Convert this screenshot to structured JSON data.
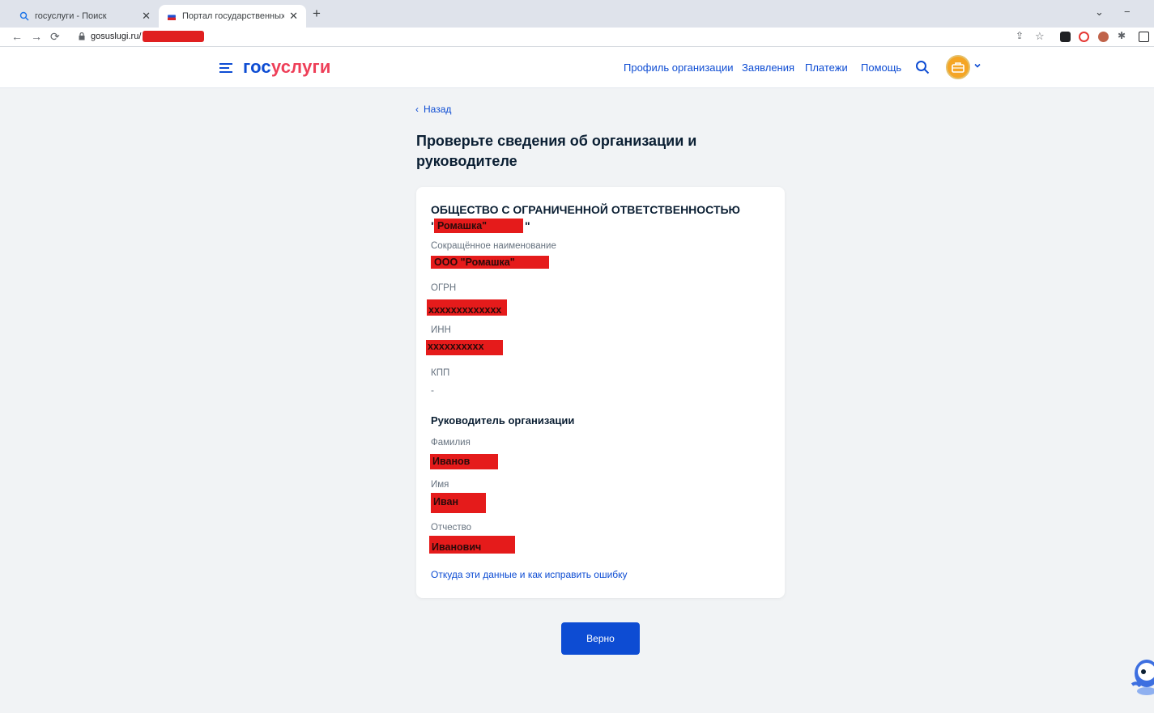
{
  "browser": {
    "tabs": [
      {
        "label": "госуслуги - Поиск",
        "active": false
      },
      {
        "label": "Портал государственных услуг",
        "active": true
      }
    ],
    "url": "gosuslugi.ru/"
  },
  "header": {
    "logo_part1": "гос",
    "logo_part2": "услуги",
    "nav": [
      "Профиль организации",
      "Заявления",
      "Платежи",
      "Помощь"
    ]
  },
  "page": {
    "back_label": "Назад",
    "title": "Проверьте сведения об организации и руководителе"
  },
  "organization": {
    "full_name": "ОБЩЕСТВО С ОГРАНИЧЕННОЙ ОТВЕТСТВЕННОСТЬЮ",
    "full_name_quote_open": "\"",
    "full_name_value": "Ромашка\"",
    "full_name_quote_close": "\"",
    "short_name_label": "Сокращённое наименование",
    "short_name": "ООО \"Ромашка\"",
    "ogrn_label": "ОГРН",
    "ogrn": "xxxxxxxxxxxxx",
    "inn_label": "ИНН",
    "inn": "xxxxxxxxxx",
    "kpp_label": "КПП",
    "kpp": "-"
  },
  "director": {
    "section_title": "Руководитель организации",
    "last_name_label": "Фамилия",
    "last_name": "Иванов",
    "first_name_label": "Имя",
    "first_name": "Иван",
    "middle_name_label": "Отчество",
    "middle_name": "Иванович"
  },
  "info_link": "Откуда эти данные и как исправить ошибку",
  "confirm_button": "Верно",
  "colors": {
    "brand_blue": "#0d4cd3",
    "brand_red": "#ee3f58",
    "redaction": "#e51b1b"
  }
}
